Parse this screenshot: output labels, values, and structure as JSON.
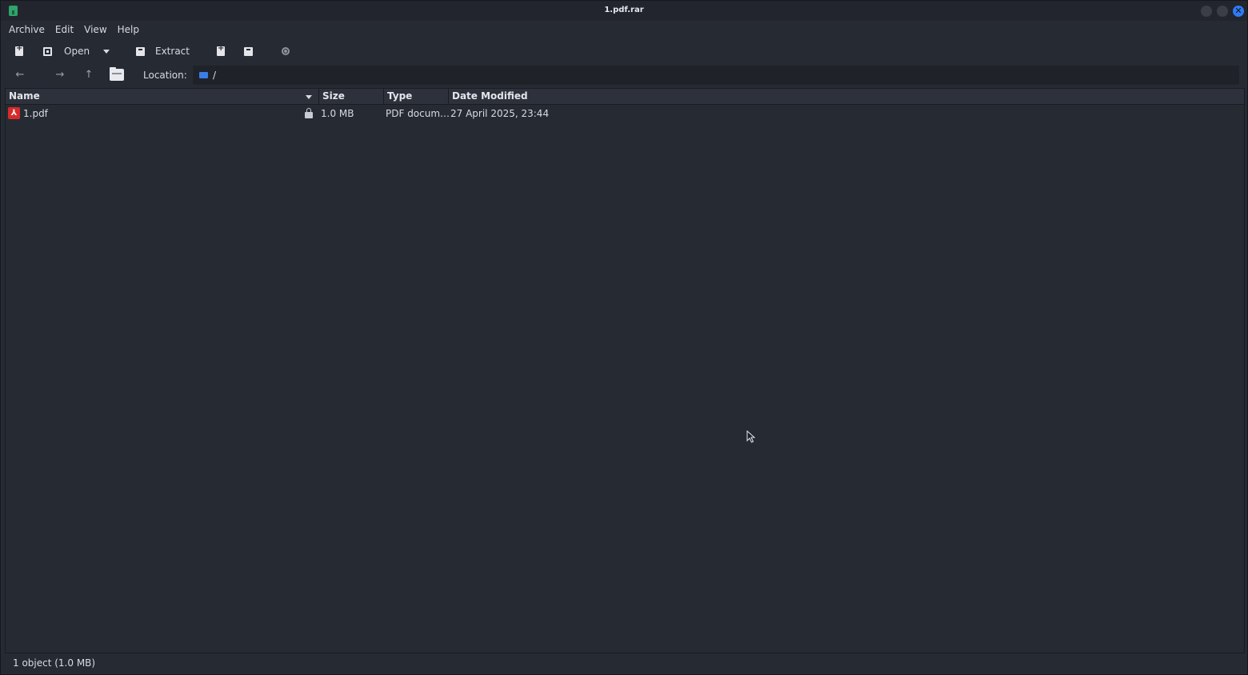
{
  "window": {
    "title": "1.pdf.rar",
    "close_glyph": "✕"
  },
  "menu": [
    "Archive",
    "Edit",
    "View",
    "Help"
  ],
  "toolbar": {
    "open_label": "Open",
    "extract_label": "Extract"
  },
  "nav": {
    "back_glyph": "←",
    "forward_glyph": "→",
    "up_glyph": "↑"
  },
  "location": {
    "label": "Location:",
    "path": "/"
  },
  "table": {
    "columns": [
      "Name",
      "Size",
      "Type",
      "Date Modified"
    ],
    "rows": [
      {
        "name": "1.pdf",
        "size": "1.0 MB",
        "type": "PDF docum…",
        "modified": "27 April 2025, 23:44",
        "icon": "pdf-icon",
        "locked": true
      }
    ]
  },
  "status": {
    "text": "1 object (1.0 MB)"
  },
  "colors": {
    "background": "#262a33",
    "accent": "#2f7bf5",
    "pdf_red": "#d62b2b",
    "app_green": "#2ea36b"
  }
}
